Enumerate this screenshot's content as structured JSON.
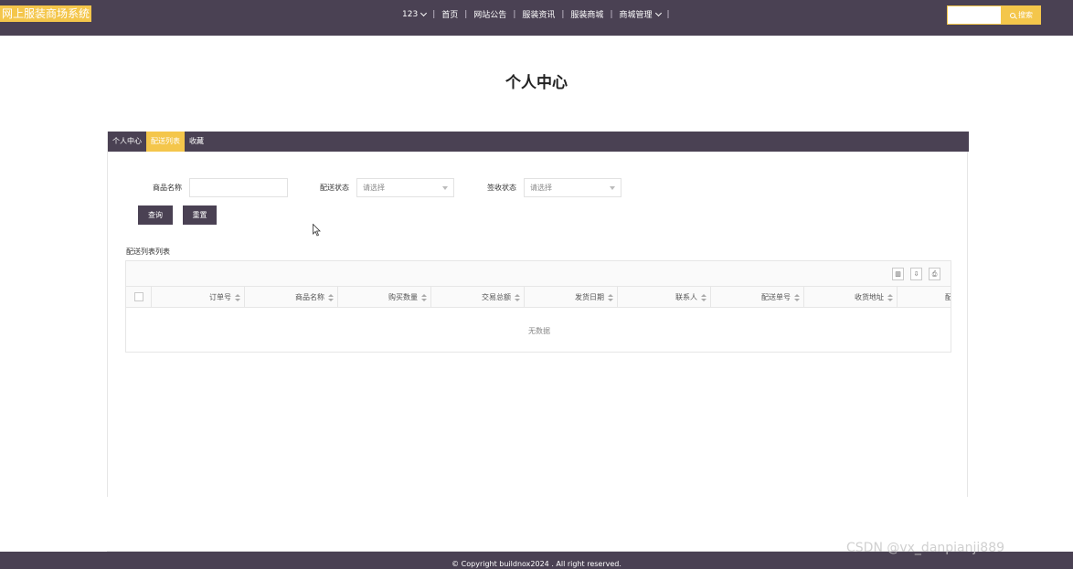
{
  "header": {
    "brand": "网上服装商场系统",
    "nav": [
      {
        "label": "123",
        "dropdown": true
      },
      {
        "label": "首页",
        "dropdown": false
      },
      {
        "label": "网站公告",
        "dropdown": false
      },
      {
        "label": "服装资讯",
        "dropdown": false
      },
      {
        "label": "服装商城",
        "dropdown": false
      },
      {
        "label": "商城管理",
        "dropdown": true
      }
    ],
    "search_button": "搜索",
    "search_value": ""
  },
  "page_title": "个人中心",
  "tabs": [
    {
      "label": "个人中心",
      "active": false
    },
    {
      "label": "配送列表",
      "active": true
    },
    {
      "label": "收藏",
      "active": false
    }
  ],
  "filters": {
    "product_name_label": "商品名称",
    "product_name_value": "",
    "delivery_status_label": "配送状态",
    "delivery_status_placeholder": "请选择",
    "sign_status_label": "签收状态",
    "sign_status_placeholder": "请选择",
    "query_button": "查询",
    "reset_button": "重置"
  },
  "list": {
    "title": "配送列表列表",
    "columns": [
      "订单号",
      "商品名称",
      "购买数量",
      "交易总额",
      "发货日期",
      "联系人",
      "配送单号",
      "收货地址",
      "配"
    ],
    "empty_text": "无数据"
  },
  "footer": {
    "copyright": "© Copyright buildnox2024 . All right reserved."
  },
  "watermark": "CSDN @vx_danpianji889",
  "colors": {
    "nav_bg": "#4a4153",
    "accent": "#f4c64b"
  }
}
